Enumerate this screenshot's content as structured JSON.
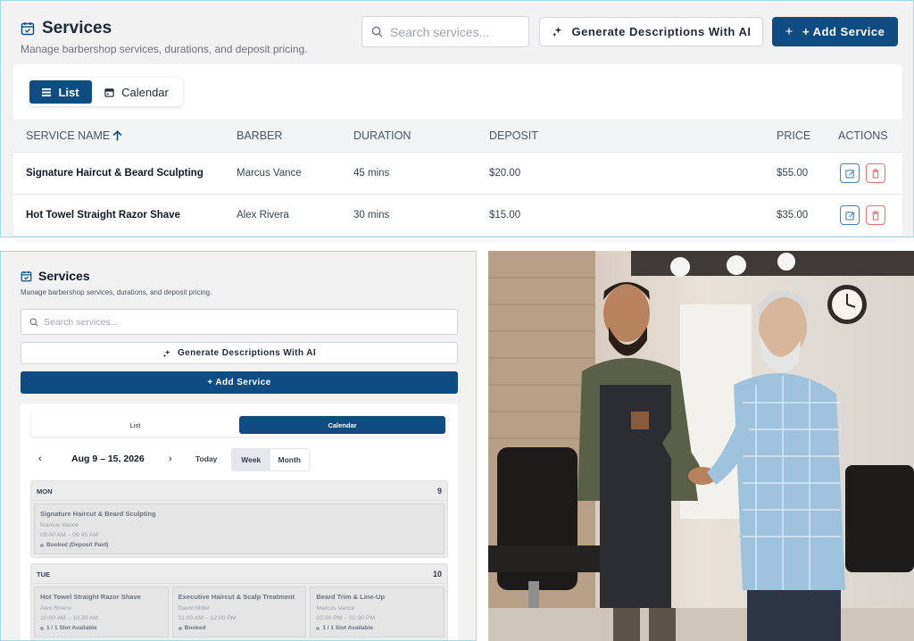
{
  "desktop": {
    "title": "Services",
    "subtitle": "Manage barbershop services, durations, and deposit pricing.",
    "search_placeholder": "Search services...",
    "generate_label": "Generate Descriptions With AI",
    "add_label": "+ Add Service",
    "view_toggle": {
      "list": "List",
      "calendar": "Calendar",
      "active": "List"
    },
    "columns": [
      "SERVICE NAME",
      "BARBER",
      "DURATION",
      "DEPOSIT",
      "PRICE",
      "ACTIONS"
    ],
    "sort_column": "SERVICE NAME",
    "rows": [
      {
        "name": "Signature Haircut & Beard Sculpting",
        "barber": "Marcus Vance",
        "duration": "45 mins",
        "deposit": "$20.00",
        "price": "$55.00"
      },
      {
        "name": "Hot Towel Straight Razor Shave",
        "barber": "Alex Rivera",
        "duration": "30 mins",
        "deposit": "$15.00",
        "price": "$35.00"
      }
    ]
  },
  "mobile": {
    "title": "Services",
    "subtitle": "Manage barbershop services, durations, and deposit pricing.",
    "search_placeholder": "Search services...",
    "generate_label": "Generate Descriptions With AI",
    "add_label": "+ Add Service",
    "view_toggle": {
      "list": "List",
      "calendar": "Calendar",
      "active": "Calendar"
    },
    "calendar": {
      "range": "Aug 9 – 15, 2026",
      "today": "Today",
      "week": "Week",
      "month": "Month",
      "active_view": "Week",
      "days": [
        {
          "name": "MON",
          "num": "9",
          "events": [
            {
              "service": "Signature Haircut & Beard Sculpting",
              "barber": "Marcus Vance",
              "time": "09:00 AM – 09:45 AM",
              "status": "Booked (Deposit Paid)"
            }
          ]
        },
        {
          "name": "TUE",
          "num": "10",
          "events": [
            {
              "service": "Hot Towel Straight Razor Shave",
              "barber": "Alex Rivera",
              "time": "10:00 AM – 10:30 AM",
              "status": "1 / 1 Slot Available"
            },
            {
              "service": "Executive Haircut & Scalp Treatment",
              "barber": "David Miller",
              "time": "11:00 AM – 12:00 PM",
              "status": "Booked"
            },
            {
              "service": "Beard Trim & Line-Up",
              "barber": "Marcus Vance",
              "time": "02:00 PM – 02:30 PM",
              "status": "1 / 1 Slot Available"
            }
          ]
        }
      ]
    }
  },
  "colors": {
    "primary": "#0f4c81",
    "panel_border": "#a8d8ea",
    "delete": "#e57373"
  }
}
